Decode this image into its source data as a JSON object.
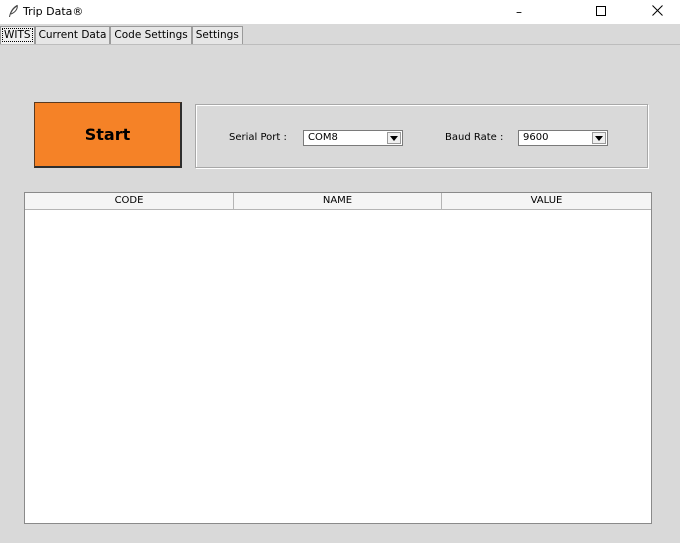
{
  "window": {
    "title": "Trip Data®",
    "minimize_glyph": "–",
    "close_glyph": "✕"
  },
  "tabs": [
    {
      "label": "WITS",
      "active": true
    },
    {
      "label": "Current Data",
      "active": false
    },
    {
      "label": "Code Settings",
      "active": false
    },
    {
      "label": "Settings",
      "active": false
    }
  ],
  "controls": {
    "start_label": "Start",
    "serial_port_label": "Serial Port :",
    "serial_port_value": "COM8",
    "baud_rate_label": "Baud Rate :",
    "baud_rate_value": "9600"
  },
  "table": {
    "columns": [
      "CODE",
      "NAME",
      "VALUE"
    ],
    "rows": []
  },
  "colors": {
    "start_button": "#f58227",
    "client_background": "#d9d9d9"
  },
  "icons": {
    "app": "feather-icon",
    "dropdown": "chevron-down-icon"
  }
}
